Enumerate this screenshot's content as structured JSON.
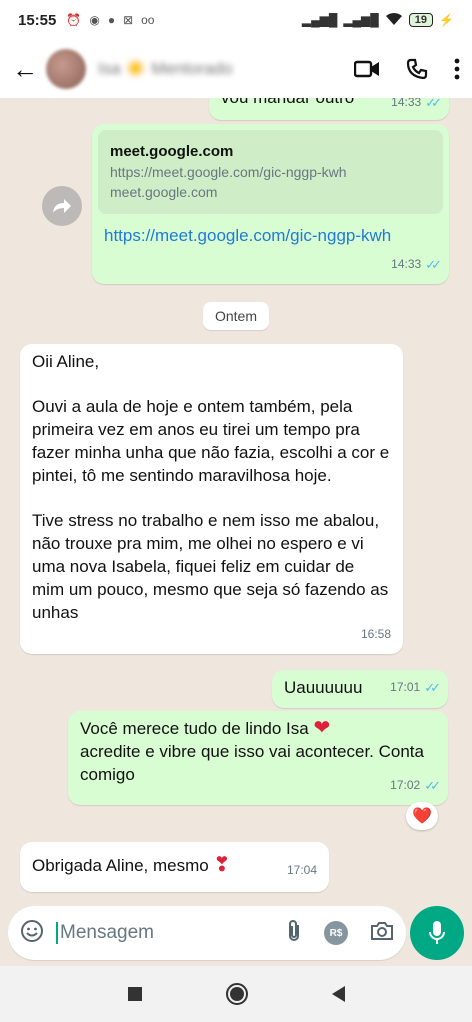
{
  "status_bar": {
    "time": "15:55",
    "battery": "19"
  },
  "header": {
    "contact_name": "Isa ☀️ Mentorado"
  },
  "messages": {
    "m0": {
      "text": "vou mandar outro",
      "time": "14:33"
    },
    "m1": {
      "preview_title": "meet.google.com",
      "preview_url": "https://meet.google.com/gic-nggp-kwh",
      "preview_domain": "meet.google.com",
      "link": "https://meet.google.com/gic-nggp-kwh",
      "time": "14:33"
    },
    "date_chip": "Ontem",
    "m2": {
      "p1": "Oii Aline,",
      "p2": "Ouvi a aula de hoje e ontem também, pela primeira vez em anos eu tirei um tempo pra fazer minha unha que não fazia, escolhi a cor e pintei, tô me sentindo maravilhosa hoje.",
      "p3": "Tive stress no trabalho e nem isso me abalou, não trouxe pra mim, me olhei no espero e vi uma nova Isabela, fiquei feliz em cuidar de mim um pouco, mesmo que seja só fazendo as unhas",
      "time": "16:58"
    },
    "m3": {
      "text": "Uauuuuuu",
      "time": "17:01"
    },
    "m4": {
      "line1": "Você merece tudo de lindo Isa",
      "line2": "acredite e vibre que isso vai acontecer. Conta comigo",
      "time": "17:02",
      "reaction": "❤️"
    },
    "m5": {
      "text": "Obrigada Aline, mesmo",
      "time": "17:04"
    }
  },
  "composer": {
    "placeholder": "Mensagem",
    "currency_icon_label": "R$"
  }
}
